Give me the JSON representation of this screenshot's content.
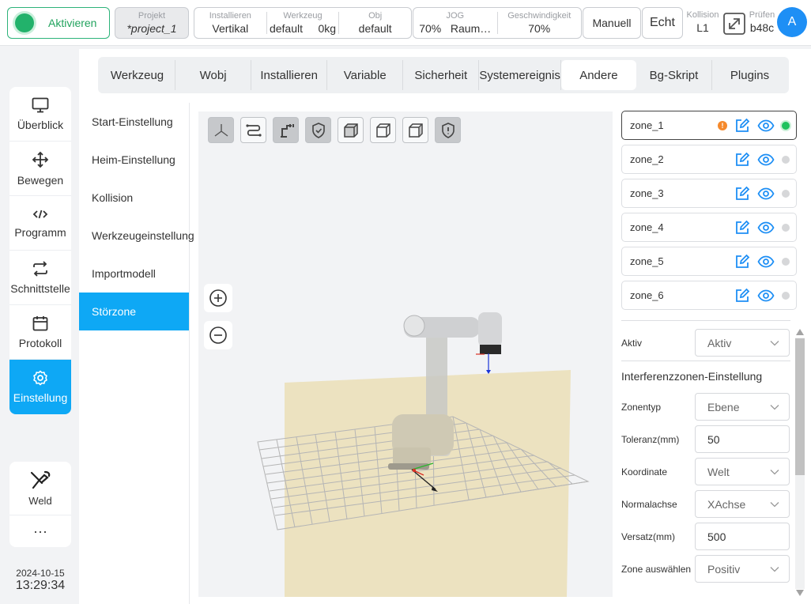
{
  "topbar": {
    "activate_label": "Aktivieren",
    "project_caption": "Projekt",
    "project_value": "*project_1",
    "install_caption": "Installieren",
    "install_value": "Vertikal",
    "tool_caption": "Werkzeug",
    "tool_value": "default     0kg",
    "obj_caption": "Obj",
    "obj_value": "default",
    "jog_caption": "JOG",
    "jog_value": "70%   Raum…",
    "speed_caption": "Geschwindigkeit",
    "speed_value": "70%",
    "mode_label": "Manuell",
    "real_label": "Echt",
    "collision_caption": "Kollision",
    "collision_value": "L1",
    "check_caption": "Prüfen",
    "check_value": "b48c",
    "avatar_letter": "A"
  },
  "nav": {
    "items": [
      {
        "label": "Überblick",
        "icon": "monitor-icon"
      },
      {
        "label": "Bewegen",
        "icon": "move-icon"
      },
      {
        "label": "Programm",
        "icon": "code-icon"
      },
      {
        "label": "Schnittstelle",
        "icon": "interface-icon"
      },
      {
        "label": "Protokoll",
        "icon": "calendar-icon"
      },
      {
        "label": "Einstellung",
        "icon": "gear-icon",
        "active": true
      }
    ],
    "weld_label": "Weld",
    "more_label": "···",
    "date": "2024-10-15",
    "time": "13:29:34"
  },
  "tabs": [
    "Werkzeug",
    "Wobj",
    "Installieren",
    "Variable",
    "Sicherheit",
    "Systemereignis",
    "Andere",
    "Bg-Skript",
    "Plugins"
  ],
  "active_tab": "Andere",
  "submenu": [
    "Start-Einstellung",
    "Heim-Einstellung",
    "Kollision",
    "Werkzeugeinstellung",
    "Importmodell",
    "Störzone"
  ],
  "active_submenu": "Störzone",
  "zones": [
    {
      "name": "zone_1",
      "warning": "!",
      "active": true
    },
    {
      "name": "zone_2",
      "active": false
    },
    {
      "name": "zone_3",
      "active": false
    },
    {
      "name": "zone_4",
      "active": false
    },
    {
      "name": "zone_5",
      "active": false
    },
    {
      "name": "zone_6",
      "active": false
    }
  ],
  "props": {
    "active_label": "Aktiv",
    "active_value": "Aktiv",
    "section_title": "Interferenzzonen-Einstellung",
    "zone_type_label": "Zonentyp",
    "zone_type_value": "Ebene",
    "tolerance_label": "Toleranz(mm)",
    "tolerance_value": "50",
    "coordinate_label": "Koordinate",
    "coordinate_value": "Welt",
    "normal_axis_label": "Normalachse",
    "normal_axis_value": "XAchse",
    "offset_label": "Versatz(mm)",
    "offset_value": "500",
    "zone_select_label": "Zone auswählen",
    "zone_select_value": "Positiv"
  },
  "colors": {
    "accent": "#0ea8f5",
    "active_green": "#22b26b",
    "warning": "#f5892b",
    "icon_blue": "#1e8ff5"
  }
}
